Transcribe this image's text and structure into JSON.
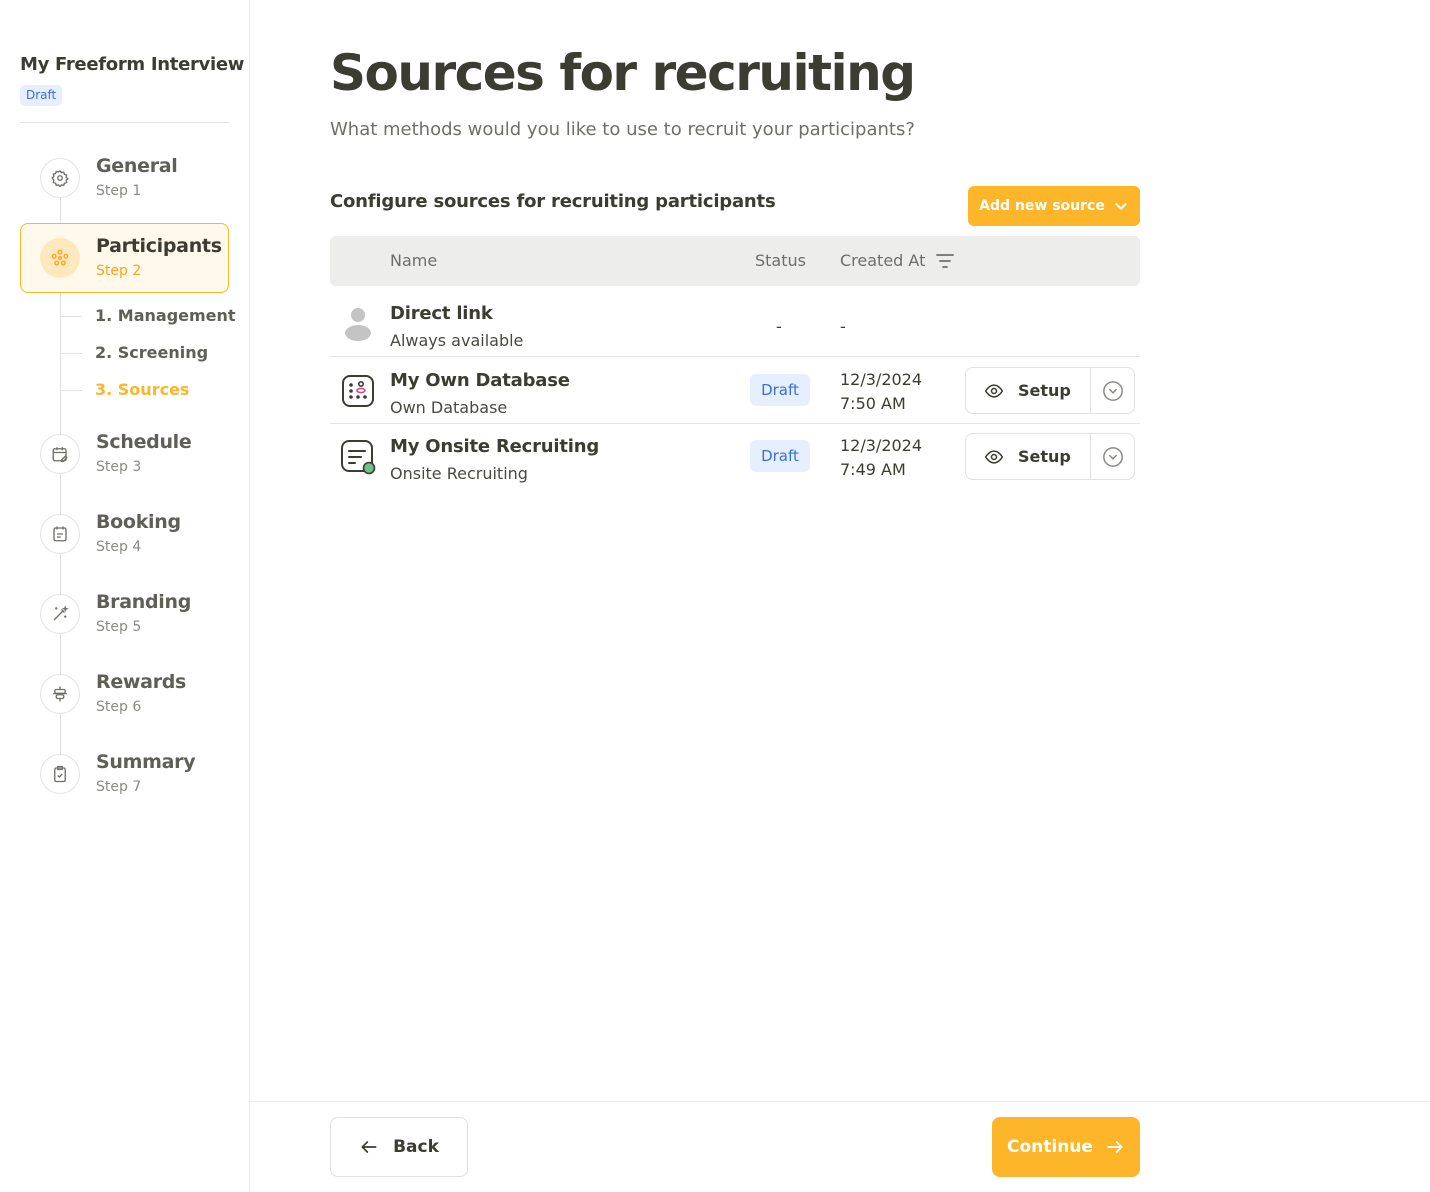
{
  "sidebar": {
    "project_title": "My Freeform Interview",
    "project_status": "Draft",
    "steps": [
      {
        "label": "General",
        "sub": "Step 1",
        "icon": "gear-icon"
      },
      {
        "label": "Participants",
        "sub": "Step 2",
        "icon": "participants-icon",
        "active": true
      },
      {
        "label": "Schedule",
        "sub": "Step 3",
        "icon": "calendar-edit-icon"
      },
      {
        "label": "Booking",
        "sub": "Step 4",
        "icon": "booking-icon"
      },
      {
        "label": "Branding",
        "sub": "Step 5",
        "icon": "magic-wand-icon"
      },
      {
        "label": "Rewards",
        "sub": "Step 6",
        "icon": "rewards-icon"
      },
      {
        "label": "Summary",
        "sub": "Step 7",
        "icon": "clipboard-check-icon"
      }
    ],
    "substeps": [
      {
        "label": "1. Management"
      },
      {
        "label": "2. Screening"
      },
      {
        "label": "3. Sources",
        "current": true
      }
    ]
  },
  "main": {
    "title": "Sources for recruiting",
    "subtitle": "What methods would you like to use to recruit your participants?",
    "section_title": "Configure sources for recruiting participants",
    "add_source_label": "Add new source",
    "table": {
      "headers": {
        "name": "Name",
        "status": "Status",
        "created_at": "Created At"
      },
      "rows": [
        {
          "name": "Direct link",
          "type": "Always available",
          "status": "-",
          "created": "-",
          "icon": "person-icon"
        },
        {
          "name": "My Own Database",
          "type": "Own Database",
          "status": "Draft",
          "created_date": "12/3/2024",
          "created_time": "7:50 AM",
          "action": "Setup",
          "icon": "database-icon"
        },
        {
          "name": "My Onsite Recruiting",
          "type": "Onsite Recruiting",
          "status": "Draft",
          "created_date": "12/3/2024",
          "created_time": "7:49 AM",
          "action": "Setup",
          "icon": "onsite-form-icon"
        }
      ]
    }
  },
  "footer": {
    "back_label": "Back",
    "continue_label": "Continue"
  },
  "colors": {
    "accent": "#fdb52a",
    "draft_badge_bg": "#e6efff",
    "draft_badge_text": "#3a6fd8",
    "text_dark": "#3c3c33"
  }
}
